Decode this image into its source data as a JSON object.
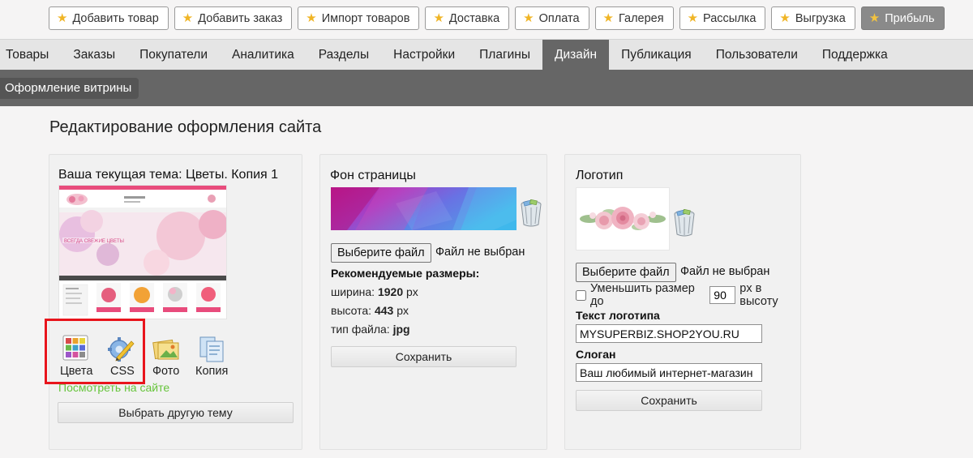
{
  "quickbar": {
    "buttons": [
      {
        "label": "Добавить товар"
      },
      {
        "label": "Добавить заказ"
      },
      {
        "label": "Импорт товаров"
      },
      {
        "label": "Доставка"
      },
      {
        "label": "Оплата"
      },
      {
        "label": "Галерея"
      },
      {
        "label": "Рассылка"
      },
      {
        "label": "Выгрузка"
      },
      {
        "label": "Прибыль"
      }
    ],
    "star_color": "#f0b526",
    "active_index": 8
  },
  "mainnav": {
    "items": [
      "Товары",
      "Заказы",
      "Покупатели",
      "Аналитика",
      "Разделы",
      "Настройки",
      "Плагины",
      "Дизайн",
      "Публикация",
      "Пользователи",
      "Поддержка"
    ],
    "active": "Дизайн"
  },
  "subnav": {
    "item": "Оформление витрины"
  },
  "page": {
    "title": "Редактирование оформления сайта"
  },
  "theme_panel": {
    "title": "Ваша текущая тема: Цветы. Копия 1",
    "thumb_banner_text": "ВСЕГДА СВЕЖИЕ ЦВЕТЫ",
    "tools": {
      "colors": "Цвета",
      "css": "CSS",
      "photo": "Фото",
      "copy": "Копия"
    },
    "view_link": "Посмотреть на сайте",
    "choose_button": "Выбрать другую тему"
  },
  "background_panel": {
    "title": "Фон страницы",
    "file_button": "Выберите файл",
    "file_status": "Файл не выбран",
    "recommended_heading": "Рекомендуемые размеры",
    "width_label": "ширина:",
    "width_value": "1920",
    "height_label": "высота:",
    "height_value": "443",
    "unit": "px",
    "filetype_label": "тип файла:",
    "filetype_value": "jpg",
    "save_button": "Сохранить"
  },
  "logo_panel": {
    "title": "Логотип",
    "file_button": "Выберите файл",
    "file_status": "Файл не выбран",
    "shrink_label": "Уменьшить размер до",
    "shrink_value": "90",
    "shrink_suffix": "px в высоту",
    "logo_text_label": "Текст логотипа",
    "logo_text_value": "MYSUPERBIZ.SHOP2YOU.RU",
    "slogan_label": "Слоган",
    "slogan_value": "Ваш любимый интернет-магазин",
    "save_button": "Сохранить"
  },
  "colors": {
    "nav_active": "#666666",
    "link_green": "#66c43a",
    "highlight_red": "#e8141c"
  }
}
